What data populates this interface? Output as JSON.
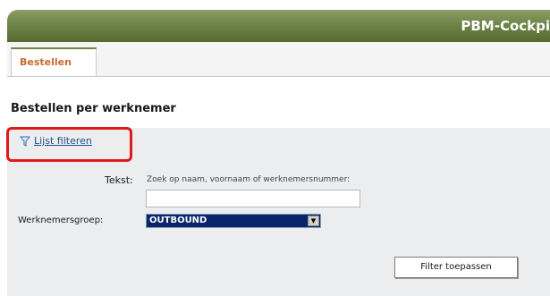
{
  "header": {
    "app_title": "PBM-Cockpi",
    "bar_color": "#6f8548"
  },
  "tabs": [
    {
      "label": "Bestellen",
      "active": true
    }
  ],
  "page": {
    "section_title": "Bestellen per werknemer"
  },
  "filter": {
    "toggle_label": "Lijst filteren",
    "toggle_icon": "funnel-icon",
    "highlight_color": "#e01a1a",
    "tekst_label": "Tekst:",
    "tekst_hint": "Zoek op naam, voornaam of werknemersnummer:",
    "tekst_value": "",
    "groep_label": "Werknemersgroep:",
    "groep_selected": "OUTBOUND",
    "apply_label": "Filter toepassen"
  }
}
